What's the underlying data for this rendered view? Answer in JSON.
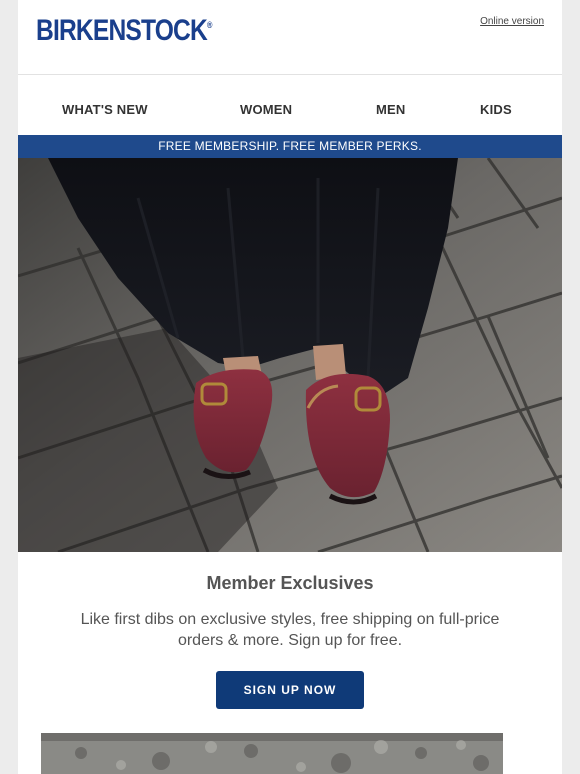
{
  "header": {
    "brand": "BIRKENSTOCK",
    "brand_mark": "®",
    "online_version": "Online version"
  },
  "nav": {
    "items": [
      {
        "label": "WHAT'S NEW"
      },
      {
        "label": "WOMEN"
      },
      {
        "label": "MEN"
      },
      {
        "label": "KIDS"
      }
    ]
  },
  "banner": {
    "text": "FREE MEMBERSHIP. FREE MEMBER PERKS."
  },
  "hero": {
    "alt": "Person in black skirt wearing burgundy suede clogs on paving stones"
  },
  "member": {
    "title": "Member Exclusives",
    "text": "Like first dibs on exclusive styles, free shipping on full-price orders & more. Sign up for free.",
    "cta": "SIGN UP NOW"
  },
  "colors": {
    "brand_blue": "#1a3f8c",
    "banner_blue": "#1f4a8c",
    "cta_blue": "#0f3a78",
    "clog": "#7b2834"
  }
}
